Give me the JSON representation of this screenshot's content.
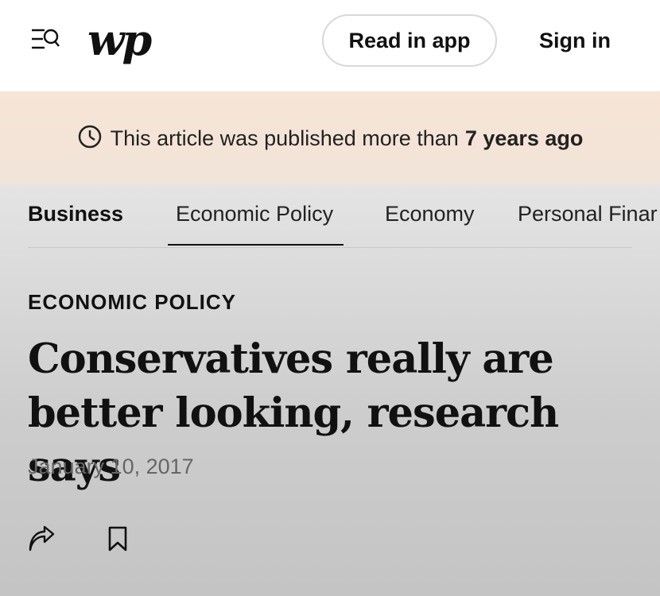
{
  "header": {
    "logo_text": "wp",
    "menu_search_icon": "menu-search-icon",
    "read_in_app_label": "Read in app",
    "sign_in_label": "Sign in"
  },
  "banner": {
    "icon": "clock-icon",
    "text": "This article was published more than",
    "emphasis": "7 years ago"
  },
  "nav": {
    "items": [
      {
        "label": "Business"
      },
      {
        "label": "Economic Policy"
      },
      {
        "label": "Economy"
      },
      {
        "label": "Personal Finar"
      }
    ],
    "active": "Economic Policy"
  },
  "article": {
    "kicker": "ECONOMIC POLICY",
    "headline": "Conservatives really are better looking, research says",
    "date": "January 10, 2017",
    "actions": [
      "share-icon",
      "bookmark-icon"
    ]
  },
  "colors": {
    "banner_bg": "#f7e5d6",
    "main_bg": "#cdcdcd",
    "text": "#111111",
    "date_text": "#666666"
  }
}
